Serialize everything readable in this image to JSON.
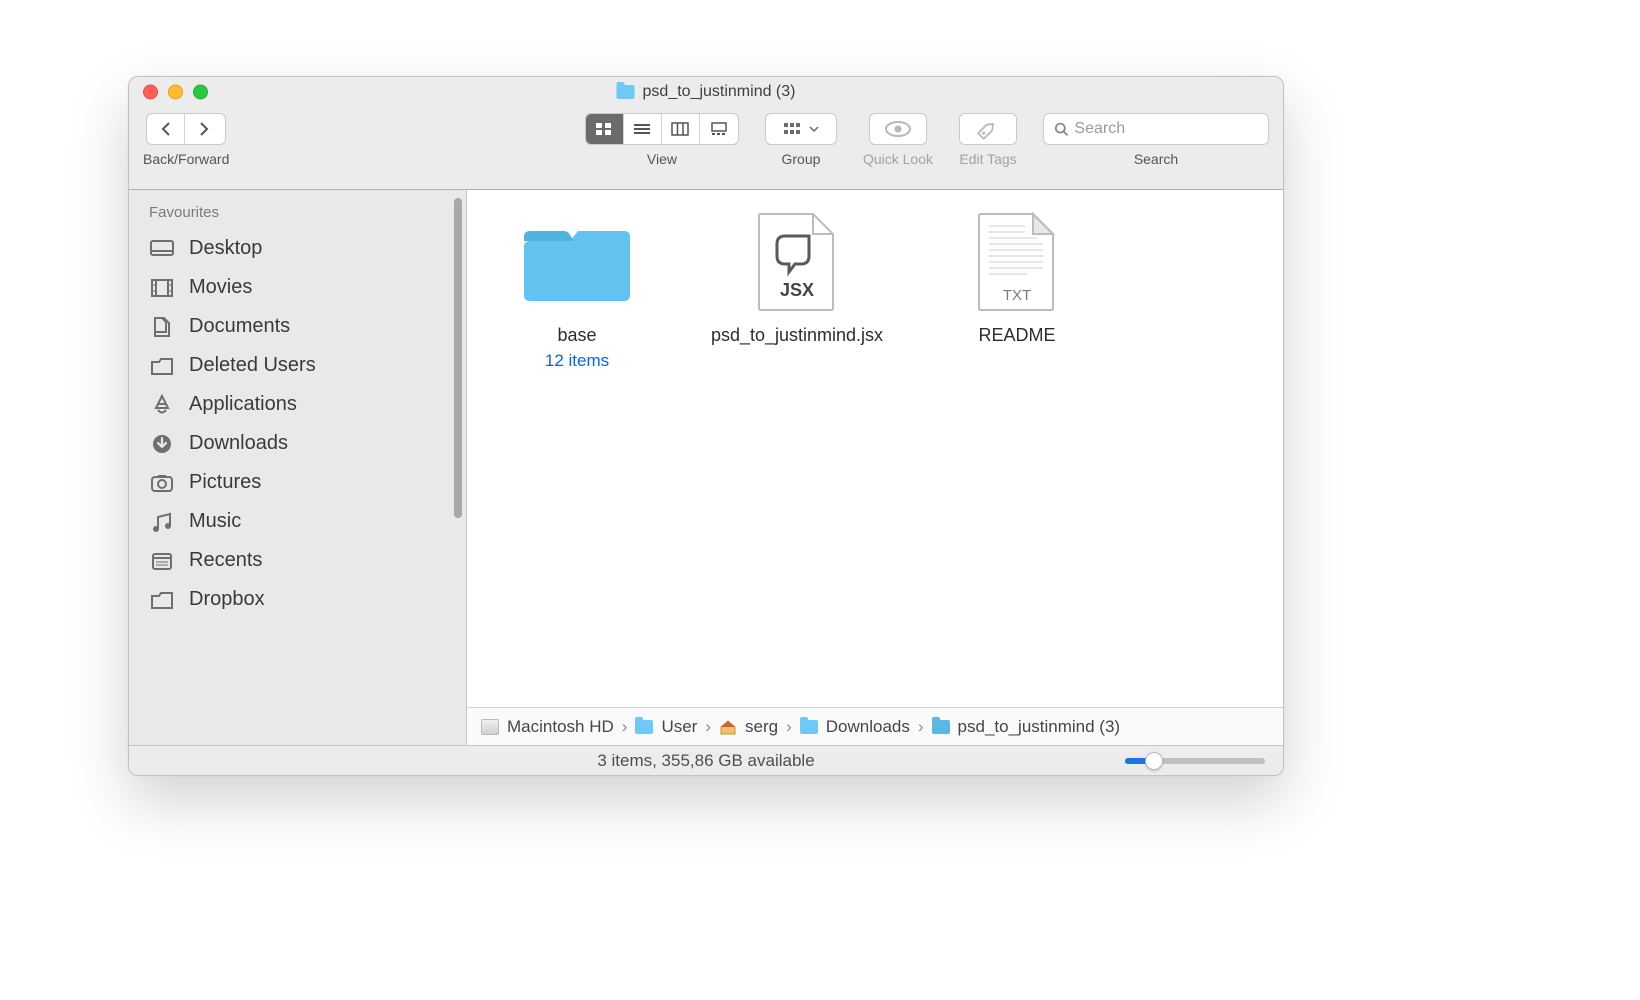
{
  "window": {
    "title": "psd_to_justinmind (3)"
  },
  "toolbar": {
    "back_forward_label": "Back/Forward",
    "view_label": "View",
    "group_label": "Group",
    "quicklook_label": "Quick Look",
    "edittags_label": "Edit Tags",
    "search_label": "Search",
    "search_placeholder": "Search"
  },
  "sidebar": {
    "section": "Favourites",
    "items": [
      {
        "label": "Desktop"
      },
      {
        "label": "Movies"
      },
      {
        "label": "Documents"
      },
      {
        "label": "Deleted Users"
      },
      {
        "label": "Applications"
      },
      {
        "label": "Downloads"
      },
      {
        "label": "Pictures"
      },
      {
        "label": "Music"
      },
      {
        "label": "Recents"
      },
      {
        "label": "Dropbox"
      }
    ]
  },
  "files": [
    {
      "name": "base",
      "sub": "12 items"
    },
    {
      "name": "psd_to_justinmind.jsx",
      "badge": "JSX"
    },
    {
      "name": "README",
      "badge": "TXT"
    }
  ],
  "path": [
    {
      "label": "Macintosh HD"
    },
    {
      "label": "User"
    },
    {
      "label": "serg"
    },
    {
      "label": "Downloads"
    },
    {
      "label": "psd_to_justinmind (3)"
    }
  ],
  "status": "3 items, 355,86 GB available"
}
